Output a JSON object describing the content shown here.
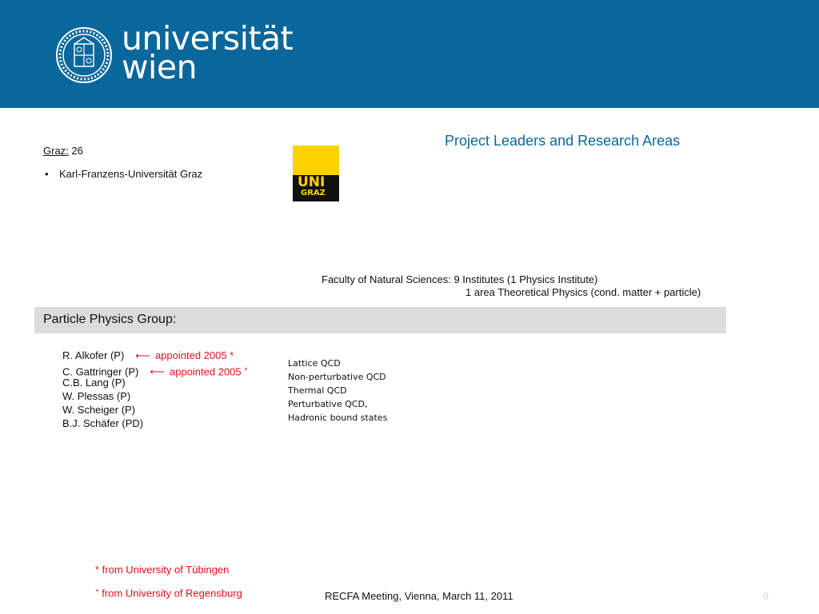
{
  "header": {
    "logo_line1": "universität",
    "logo_line2": "wien",
    "brand_color": "#0a679b"
  },
  "slide": {
    "title": "Project Leaders and Research Areas",
    "graz_label": "Graz:",
    "graz_count": "26",
    "graz_bullet": "•",
    "graz_university": "Karl-Franzens-Universität Graz",
    "unigraz_logo": {
      "line1": "UNI",
      "line2": "GRAZ",
      "color": "#fdd200"
    },
    "faculty_line1": "Faculty of Natural Sciences: 9 Institutes (1 Physics Institute)",
    "faculty_line2": "1 area Theoretical Physics  (cond. matter + particle)",
    "group_heading": "Particle Physics Group:",
    "members": [
      {
        "name": "R. Alkofer (P)",
        "arrow": "⟵",
        "note": "appointed 2005 *"
      },
      {
        "name": "C. Gattringer (P)",
        "arrow": "⟵",
        "note": "appointed 2005",
        "mark": "+"
      },
      {
        "name": "C.B. Lang (P)"
      },
      {
        "name": "W. Plessas (P)"
      },
      {
        "name": "W. Scheiger (P)"
      },
      {
        "name": "B.J. Schäfer (PD)"
      }
    ],
    "research_areas": [
      "Lattice QCD",
      "Non-perturbative QCD",
      "Thermal QCD",
      "Perturbative QCD,",
      "Hadronic bound states"
    ],
    "footnote1": "* from University of Tübingen",
    "footnote2_mark": "+",
    "footnote2": "from University of Regensburg",
    "footer": "RECFA Meeting, Vienna, March 11, 2011",
    "page_number": "9",
    "accent_red": "#e0101a"
  }
}
